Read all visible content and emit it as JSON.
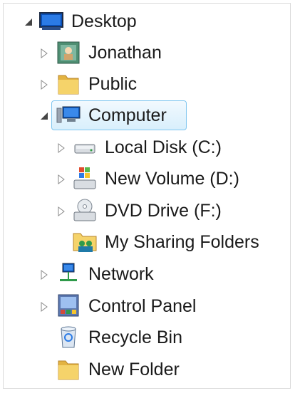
{
  "tree": {
    "items": [
      {
        "label": "Desktop",
        "icon": "desktop-icon",
        "expander": "expanded"
      },
      {
        "label": "Jonathan",
        "icon": "user-folder-icon",
        "expander": "collapsed"
      },
      {
        "label": "Public",
        "icon": "folder-icon",
        "expander": "collapsed"
      },
      {
        "label": "Computer",
        "icon": "computer-icon",
        "expander": "expanded",
        "selected": true
      },
      {
        "label": "Local Disk (C:)",
        "icon": "hard-drive-icon",
        "expander": "collapsed"
      },
      {
        "label": "New Volume (D:)",
        "icon": "windows-drive-icon",
        "expander": "collapsed"
      },
      {
        "label": "DVD Drive (F:)",
        "icon": "dvd-drive-icon",
        "expander": "collapsed"
      },
      {
        "label": "My Sharing Folders",
        "icon": "sharing-folder-icon",
        "expander": "none"
      },
      {
        "label": "Network",
        "icon": "network-icon",
        "expander": "collapsed"
      },
      {
        "label": "Control Panel",
        "icon": "control-panel-icon",
        "expander": "collapsed"
      },
      {
        "label": "Recycle Bin",
        "icon": "recycle-bin-icon",
        "expander": "none"
      },
      {
        "label": "New Folder",
        "icon": "folder-icon",
        "expander": "none"
      }
    ]
  },
  "colors": {
    "selection_border": "#7fc6f0",
    "selection_fill": "#d8effc",
    "folder_yellow": "#f2c94c"
  }
}
